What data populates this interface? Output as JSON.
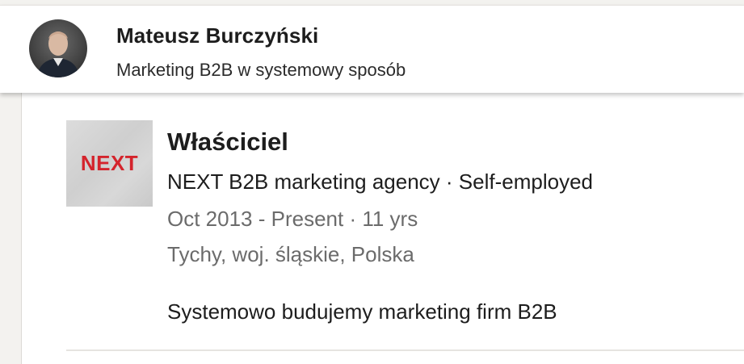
{
  "header": {
    "name": "Mateusz Burczyński",
    "headline": "Marketing B2B w systemowy sposób"
  },
  "experience": {
    "logo_text": "NEXT",
    "title": "Właściciel",
    "company": "NEXT B2B marketing agency · Self-employed",
    "dates": "Oct 2013 - Present · 11 yrs",
    "location": "Tychy, woj. śląskie, Polska",
    "description": "Systemowo budujemy marketing firm B2B"
  },
  "colors": {
    "logo_red": "#d4242c",
    "secondary_text": "#6b6b6b",
    "primary_text": "#1d1d1d"
  }
}
